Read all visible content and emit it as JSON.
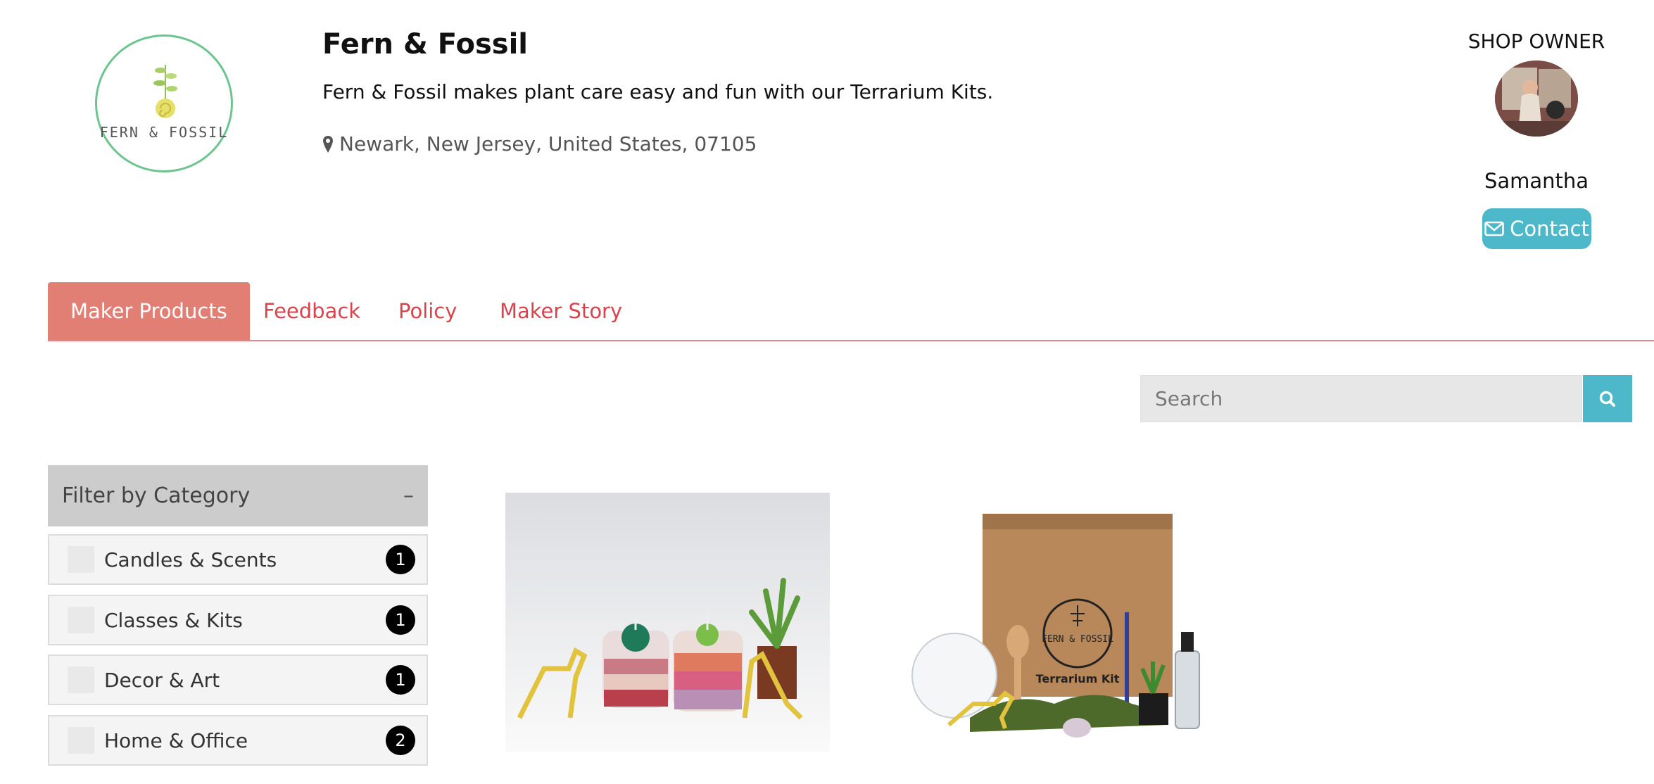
{
  "shop": {
    "logo_text": "FERN & FOSSIL",
    "name": "Fern & Fossil",
    "description": "Fern & Fossil makes plant care easy and fun with our Terrarium Kits.",
    "location": "Newark, New Jersey, United States, 07105"
  },
  "owner": {
    "label": "SHOP OWNER",
    "name": "Samantha",
    "contact_label": "Contact"
  },
  "tabs": [
    {
      "label": "Maker Products",
      "active": true
    },
    {
      "label": "Feedback",
      "active": false
    },
    {
      "label": "Policy",
      "active": false
    },
    {
      "label": "Maker Story",
      "active": false
    }
  ],
  "search": {
    "placeholder": "Search"
  },
  "filter": {
    "title": "Filter by Category",
    "toggle": "–",
    "categories": [
      {
        "label": "Candles & Scents",
        "count": "1"
      },
      {
        "label": "Classes & Kits",
        "count": "1"
      },
      {
        "label": "Decor & Art",
        "count": "1"
      },
      {
        "label": "Home & Office",
        "count": "2"
      }
    ]
  },
  "products": [
    {
      "image": "terrarium candles with dinosaur figures"
    },
    {
      "image": "terrarium kit box",
      "box_label": "Terrarium Kit",
      "box_logo": "FERN & FOSSIL"
    }
  ],
  "colors": {
    "accent": "#e27f75",
    "tab_text": "#d9434c",
    "teal": "#4db8c9",
    "logo_ring": "#6cc58f"
  }
}
